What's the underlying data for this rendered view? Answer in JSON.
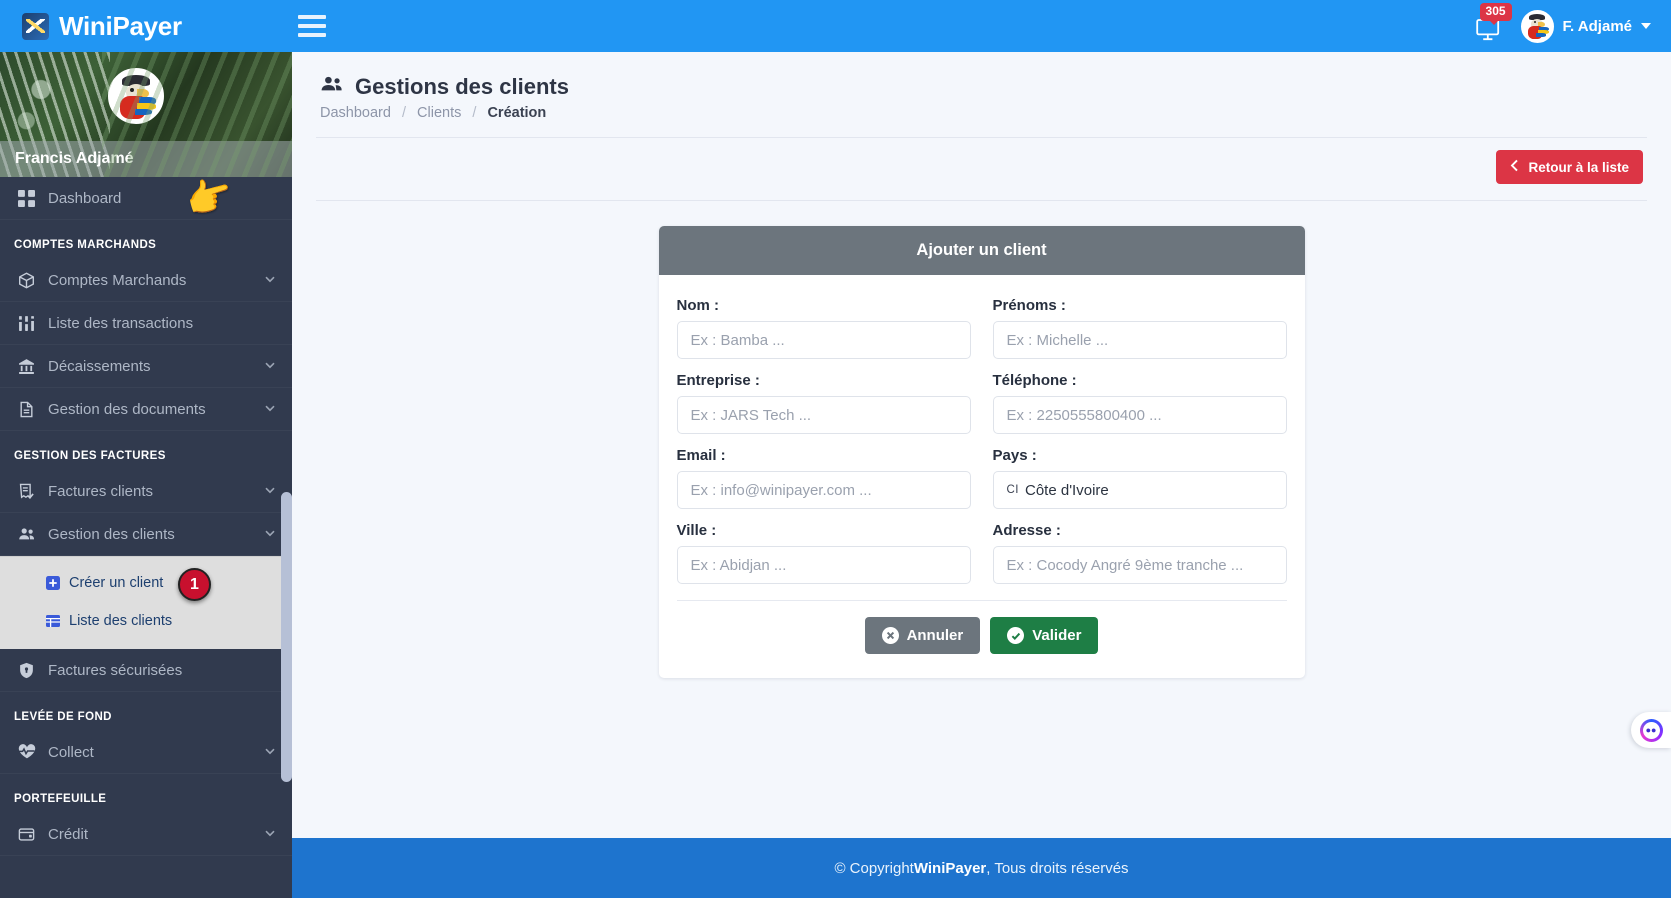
{
  "topbar": {
    "brand": "WiniPayer",
    "brand_logo_icon": "chart-logo-icon",
    "menu_toggle_icon": "hamburger-icon",
    "notification_icon": "bell-screen-icon",
    "notification_count": "305",
    "user_name": "F. Adjamé",
    "user_caret_icon": "caret-down-icon"
  },
  "sidebar": {
    "profile_name": "Francis Adjamé",
    "pointer_icon": "pointing-hand-icon",
    "groups": [
      {
        "section": null,
        "items": [
          {
            "label": "Dashboard",
            "icon": "grid-icon",
            "chevron": false
          }
        ]
      },
      {
        "section": "COMPTES MARCHANDS",
        "items": [
          {
            "label": "Comptes Marchands",
            "icon": "box-icon",
            "chevron": true
          },
          {
            "label": "Liste des transactions",
            "icon": "sliders-icon",
            "chevron": false
          },
          {
            "label": "Décaissements",
            "icon": "bank-icon",
            "chevron": true
          },
          {
            "label": "Gestion des documents",
            "icon": "document-icon",
            "chevron": true
          }
        ]
      },
      {
        "section": "GESTION DES FACTURES",
        "items": [
          {
            "label": "Factures clients",
            "icon": "invoice-check-icon",
            "chevron": true
          },
          {
            "label": "Gestion des clients",
            "icon": "users-icon",
            "chevron": true
          }
        ]
      }
    ],
    "submenu": {
      "items": [
        {
          "label": "Créer un client",
          "icon": "plus-square-icon"
        },
        {
          "label": "Liste des clients",
          "icon": "list-table-icon"
        }
      ],
      "step_badge": "1"
    },
    "after_submenu": [
      {
        "label": "Factures sécurisées",
        "icon": "shield-lock-icon",
        "chevron": false
      }
    ],
    "groups_tail": [
      {
        "section": "LEVÉE DE FOND",
        "items": [
          {
            "label": "Collect",
            "icon": "heart-pulse-icon",
            "chevron": true
          }
        ]
      },
      {
        "section": "PORTEFEUILLE",
        "items": [
          {
            "label": "Crédit",
            "icon": "wallet-icon",
            "chevron": true
          }
        ]
      }
    ]
  },
  "page": {
    "title": "Gestions des clients",
    "title_icon": "users-icon",
    "breadcrumb": [
      {
        "label": "Dashboard",
        "current": false
      },
      {
        "label": "Clients",
        "current": false
      },
      {
        "label": "Création",
        "current": true
      }
    ],
    "back_button": {
      "label": "Retour à la liste",
      "icon": "chevron-left-icon"
    }
  },
  "form": {
    "card_title": "Ajouter un client",
    "fields": [
      {
        "label": "Nom :",
        "placeholder": "Ex : Bamba ...",
        "value": "",
        "type": "text",
        "name": "nom"
      },
      {
        "label": "Prénoms :",
        "placeholder": "Ex : Michelle ...",
        "value": "",
        "type": "text",
        "name": "prenoms"
      },
      {
        "label": "Entreprise :",
        "placeholder": "Ex : JARS Tech ...",
        "value": "",
        "type": "text",
        "name": "entreprise"
      },
      {
        "label": "Téléphone :",
        "placeholder": "Ex : 2250555800400 ...",
        "value": "",
        "type": "text",
        "name": "telephone"
      },
      {
        "label": "Email :",
        "placeholder": "Ex : info@winipayer.com ...",
        "value": "",
        "type": "text",
        "name": "email"
      },
      {
        "label": "Pays :",
        "placeholder": "",
        "value": "Côte d'Ivoire",
        "country_code": "CI",
        "type": "select",
        "name": "pays"
      },
      {
        "label": "Ville :",
        "placeholder": "Ex : Abidjan ...",
        "value": "",
        "type": "text",
        "name": "ville"
      },
      {
        "label": "Adresse :",
        "placeholder": "Ex : Cocody Angré 9ème tranche ...",
        "value": "",
        "type": "text",
        "name": "adresse"
      }
    ],
    "cancel_button": {
      "label": "Annuler",
      "icon": "x-circle-icon"
    },
    "submit_button": {
      "label": "Valider",
      "icon": "check-circle-icon"
    }
  },
  "footer": {
    "prefix": "© Copyright ",
    "brand": "WiniPayer",
    "suffix": ", Tous droits réservés"
  },
  "chat_widget": {
    "icon": "chat-bubble-icon"
  },
  "colors": {
    "primary": "#2196f3",
    "sidebar": "#313a4e",
    "danger": "#dc3545",
    "success": "#1e7e45",
    "secondary": "#6c757d",
    "footer": "#1e74ce",
    "page_bg": "#f4f7fc"
  }
}
